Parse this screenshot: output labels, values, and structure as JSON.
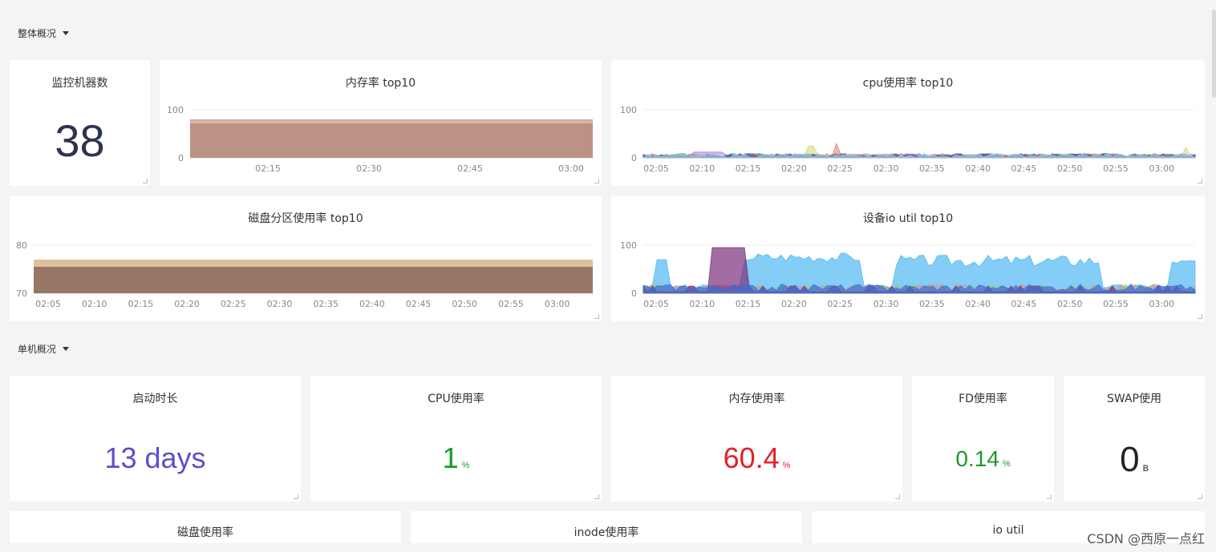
{
  "sections": {
    "overall": {
      "label": "整体概况"
    },
    "single": {
      "label": "单机概况"
    }
  },
  "panels": {
    "machine_count": {
      "title": "监控机器数",
      "value": "38",
      "color": "#2e3350"
    },
    "uptime": {
      "title": "启动时长",
      "value": "13 days",
      "color": "#5b4fc9"
    },
    "cpu_usage": {
      "title": "CPU使用率",
      "value": "1",
      "unit": "%",
      "color": "#1a9a2a"
    },
    "mem_usage": {
      "title": "内存使用率",
      "value": "60.4",
      "unit": "%",
      "color": "#e4202c"
    },
    "fd_usage": {
      "title": "FD使用率",
      "value": "0.14",
      "unit": "%",
      "color": "#1a9a2a"
    },
    "swap_usage": {
      "title": "SWAP使用",
      "value": "0",
      "unit": "B",
      "color": "#222"
    },
    "disk_usage": {
      "title": "磁盘使用率"
    },
    "inode_usage": {
      "title": "inode使用率"
    },
    "io_util": {
      "title": "io util"
    }
  },
  "watermark": "CSDN @西原一点红",
  "chart_data": [
    {
      "type": "area",
      "title": "内存率 top10",
      "x_ticks": [
        "02:15",
        "02:30",
        "02:45",
        "03:00"
      ],
      "y_ticks": [
        "100",
        "0"
      ],
      "ylim": [
        0,
        100
      ],
      "series_colors": [
        "#c48bd1",
        "#e8c27a",
        "#b58a86"
      ],
      "bands": [
        80,
        77,
        72
      ]
    },
    {
      "type": "area",
      "title": "cpu使用率 top10",
      "x_ticks": [
        "02:05",
        "02:10",
        "02:15",
        "02:20",
        "02:25",
        "02:30",
        "02:35",
        "02:40",
        "02:45",
        "02:50",
        "02:55",
        "03:00"
      ],
      "y_ticks": [
        "100",
        "0"
      ],
      "ylim": [
        0,
        100
      ]
    },
    {
      "type": "area",
      "title": "磁盘分区使用率 top10",
      "x_ticks": [
        "02:05",
        "02:10",
        "02:15",
        "02:20",
        "02:25",
        "02:30",
        "02:35",
        "02:40",
        "02:45",
        "02:50",
        "02:55",
        "03:00"
      ],
      "y_ticks": [
        "80",
        "70"
      ],
      "ylim": [
        70,
        80
      ],
      "series_colors": [
        "#d9b48c",
        "#8a6a5c"
      ],
      "bands": [
        77,
        75.5
      ]
    },
    {
      "type": "area",
      "title": "设备io util top10",
      "x_ticks": [
        "02:05",
        "02:10",
        "02:15",
        "02:20",
        "02:25",
        "02:30",
        "02:35",
        "02:40",
        "02:45",
        "02:50",
        "02:55",
        "03:00"
      ],
      "y_ticks": [
        "100",
        "0"
      ],
      "ylim": [
        0,
        100
      ]
    }
  ]
}
